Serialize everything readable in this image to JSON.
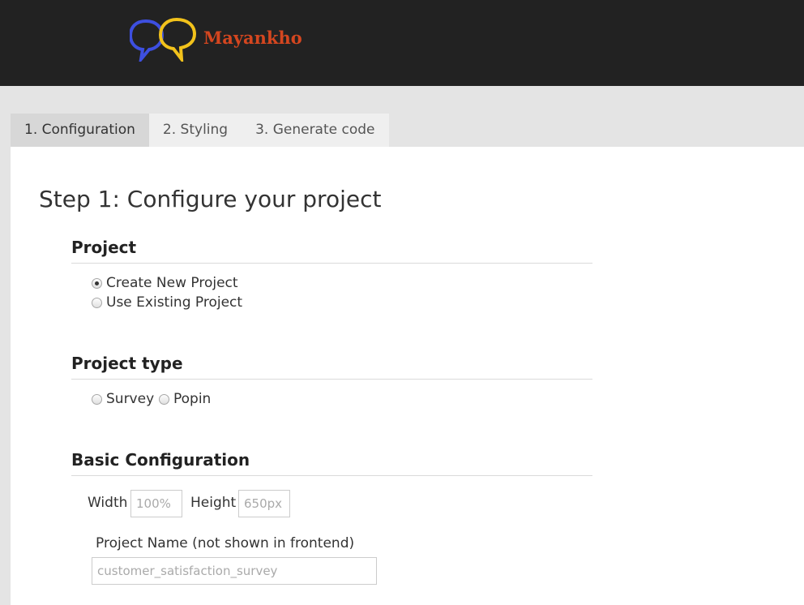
{
  "app": {
    "brand_name": "Mayankho",
    "logo_icon": "speech-bubbles-logo",
    "brand_color": "#d4461f",
    "bubble_colors": [
      "#3d4fe0",
      "#f2c21b"
    ]
  },
  "tabs": [
    {
      "label": "1. Configuration",
      "active": true
    },
    {
      "label": "2. Styling",
      "active": false
    },
    {
      "label": "3. Generate code",
      "active": false
    }
  ],
  "main": {
    "title": "Step 1: Configure your project",
    "project_section": {
      "title": "Project",
      "options": [
        {
          "label": "Create New Project",
          "checked": true
        },
        {
          "label": "Use Existing Project",
          "checked": false
        }
      ]
    },
    "type_section": {
      "title": "Project type",
      "options": [
        {
          "label": "Survey",
          "checked": false
        },
        {
          "label": "Popin",
          "checked": false
        }
      ]
    },
    "basic_section": {
      "title": "Basic Configuration",
      "width_label": "Width",
      "width_placeholder": "100%",
      "height_label": "Height",
      "height_placeholder": "650px",
      "name_label": "Project Name (not shown in frontend)",
      "name_placeholder": "customer_satisfaction_survey"
    }
  }
}
